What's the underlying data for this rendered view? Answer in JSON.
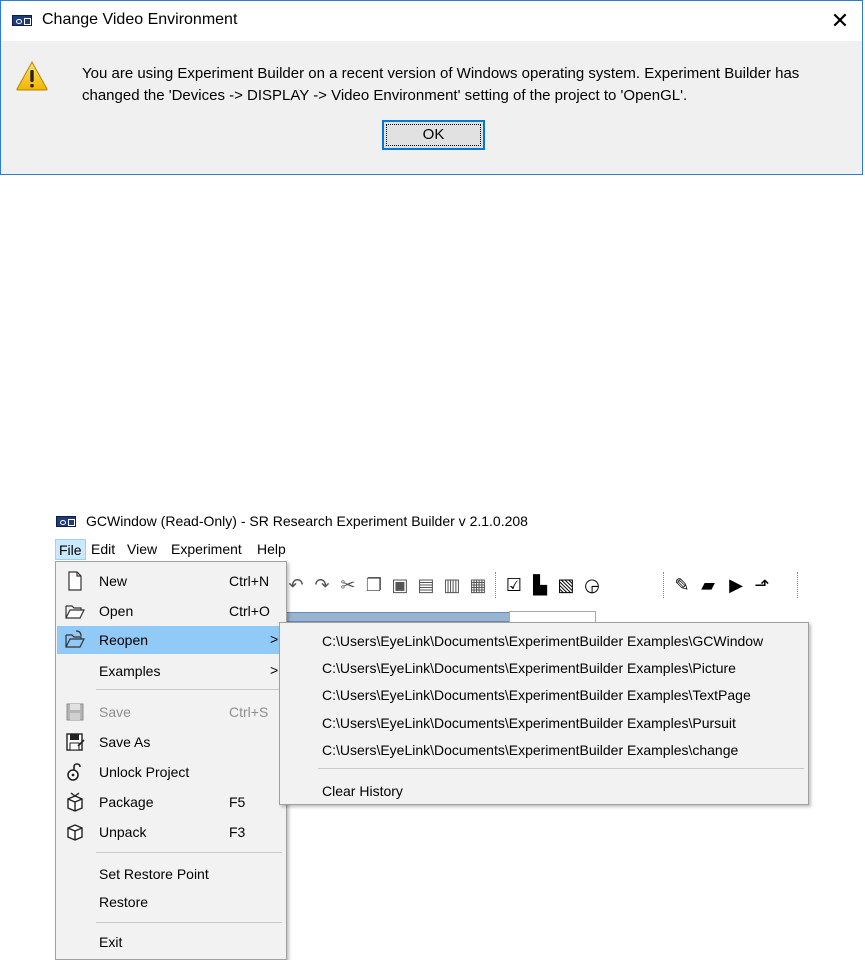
{
  "dialog": {
    "title": "Change Video Environment",
    "close_glyph": "✕",
    "message": "You are using Experiment Builder on a recent version of Windows operating system. Experiment Builder has changed the 'Devices -> DISPLAY -> Video Environment' setting of the project to 'OpenGL'.",
    "ok_label": "OK",
    "icon": "warning-icon"
  },
  "window": {
    "title": "GCWindow (Read-Only) - SR Research Experiment Builder v 2.1.0.208"
  },
  "menubar": {
    "items": [
      "File",
      "Edit",
      "View",
      "Experiment",
      "Help"
    ],
    "active": "File"
  },
  "file_menu": {
    "items": [
      {
        "label": "New",
        "shortcut": "Ctrl+N",
        "icon": "new-document-icon"
      },
      {
        "label": "Open",
        "shortcut": "Ctrl+O",
        "icon": "open-folder-icon"
      },
      {
        "label": "Reopen",
        "shortcut": "",
        "arrow": ">",
        "icon": "reopen-folder-icon"
      },
      {
        "label": "Examples",
        "shortcut": "",
        "arrow": ">",
        "icon": ""
      },
      {
        "label": "Save",
        "shortcut": "Ctrl+S",
        "icon": "save-icon",
        "disabled": true
      },
      {
        "label": "Save As",
        "shortcut": "",
        "icon": "save-as-icon"
      },
      {
        "label": "Unlock Project",
        "shortcut": "",
        "icon": "unlock-icon"
      },
      {
        "label": "Package",
        "shortcut": "F5",
        "icon": "package-icon"
      },
      {
        "label": "Unpack",
        "shortcut": "F3",
        "icon": "unpack-icon"
      },
      {
        "label": "Set Restore Point",
        "shortcut": "",
        "icon": ""
      },
      {
        "label": "Restore",
        "shortcut": "",
        "icon": ""
      },
      {
        "label": "Exit",
        "shortcut": "",
        "icon": ""
      }
    ],
    "highlighted": "Reopen"
  },
  "reopen_menu": {
    "items": [
      "C:\\Users\\EyeLink\\Documents\\ExperimentBuilder Examples\\GCWindow",
      "C:\\Users\\EyeLink\\Documents\\ExperimentBuilder Examples\\Picture",
      "C:\\Users\\EyeLink\\Documents\\ExperimentBuilder Examples\\TextPage",
      "C:\\Users\\EyeLink\\Documents\\ExperimentBuilder Examples\\Pursuit",
      "C:\\Users\\EyeLink\\Documents\\ExperimentBuilder Examples\\change"
    ],
    "clear_label": "Clear History"
  },
  "colors": {
    "highlight": "#91c9f7",
    "menu_bg": "#f2f2f2",
    "dialog_border": "#2b7cd3",
    "ok_border": "#0078d7"
  }
}
